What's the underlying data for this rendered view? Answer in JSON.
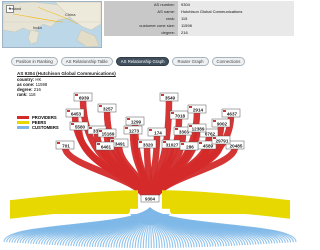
{
  "map": {
    "labels": [
      "India",
      "China",
      "Ireland"
    ],
    "zoom_label": "+"
  },
  "summary": {
    "rows": [
      {
        "key": "AS number:",
        "value": "9304"
      },
      {
        "key": "AS name:",
        "value": "Hutchison Global Communications"
      },
      {
        "key": "rank:",
        "value": "115"
      },
      {
        "key": "customer cone size:",
        "value": "11598"
      },
      {
        "key": "degree:",
        "value": "216"
      }
    ]
  },
  "tabs": [
    {
      "label": "Position in Ranking",
      "active": false
    },
    {
      "label": "AS Relationship Table",
      "active": false
    },
    {
      "label": "AS Relationship Graph",
      "active": true
    },
    {
      "label": "Router Graph",
      "active": false
    },
    {
      "label": "Connections",
      "active": false
    }
  ],
  "as_info": {
    "title": "AS 9304 (Hutchison Global Communications)",
    "country_key": "country:",
    "country_value": "HK",
    "cone_key": "as cone:",
    "cone_value": "11598",
    "degree_key": "degree:",
    "degree_value": "216",
    "rank_key": "rank:",
    "rank_value": "118"
  },
  "legend": [
    {
      "label": "PROVIDERS",
      "color": "#d42a2a"
    },
    {
      "label": "PEERS",
      "color": "#e6d800"
    },
    {
      "label": "CUSTOMERS",
      "color": "#7fb8e8"
    }
  ],
  "graph": {
    "center_node": "9304",
    "providers": [
      "6939",
      "3257",
      "1299",
      "3549",
      "7018",
      "2914",
      "6453",
      "3356",
      "4637",
      "9002",
      "174",
      "3491",
      "6461",
      "6762",
      "1273",
      "15169",
      "3303",
      "4589",
      "5580",
      "20485",
      "12389",
      "29791",
      "31027",
      "3320",
      "286",
      "701"
    ],
    "colors": {
      "providers": "#d42a2a",
      "peers": "#e6d800",
      "customers": "#7fb8e8",
      "node_border": "#555555",
      "node_label": "#222222"
    }
  }
}
